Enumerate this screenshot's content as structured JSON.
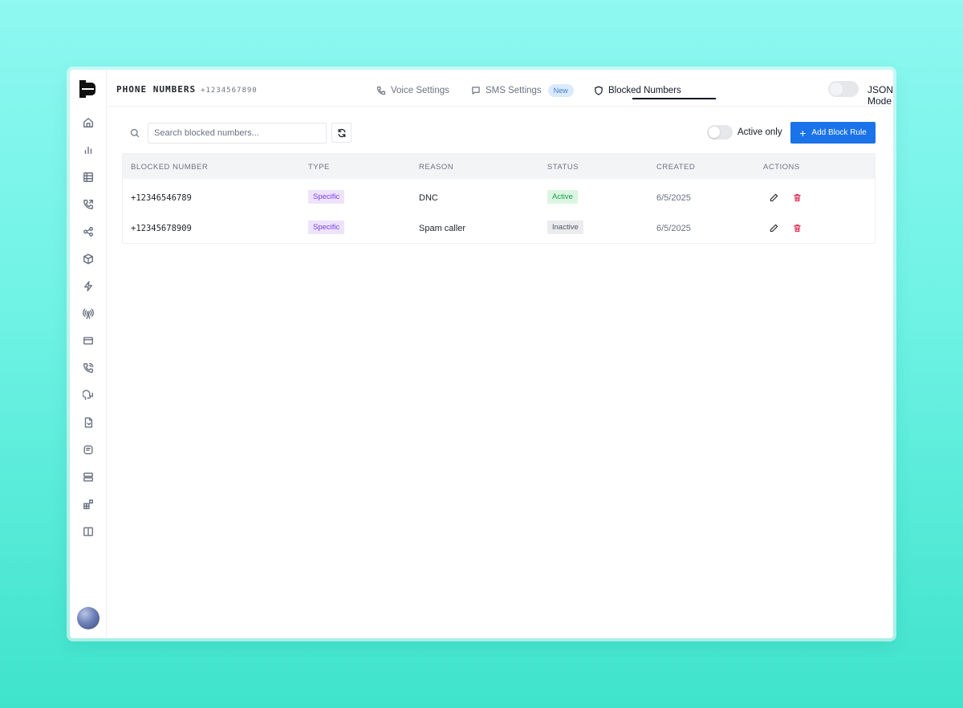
{
  "header": {
    "title": "PHONE NUMBERS",
    "phone": "+1234567890",
    "json_mode_label": "JSON Mode"
  },
  "tabs": [
    {
      "label": "Voice Settings",
      "icon": "phone-icon",
      "active": false
    },
    {
      "label": "SMS Settings",
      "icon": "message-icon",
      "badge": "New",
      "active": false
    },
    {
      "label": "Blocked Numbers",
      "icon": "shield-icon",
      "active": true
    }
  ],
  "sidebar": {
    "items": [
      "home-icon",
      "analytics-icon",
      "table-icon",
      "phone-forward-icon",
      "share-icon",
      "package-icon",
      "bolt-icon",
      "broadcast-icon",
      "credit-card-icon",
      "phone-call-icon",
      "voice-icon",
      "file-icon",
      "message-square-icon",
      "server-icon",
      "widgets-icon",
      "columns-icon"
    ]
  },
  "toolbar": {
    "search_placeholder": "Search blocked numbers...",
    "search_value": "",
    "active_only_label": "Active only",
    "active_only": false,
    "add_button_label": "Add Block Rule"
  },
  "table": {
    "columns": [
      "BLOCKED NUMBER",
      "TYPE",
      "REASON",
      "STATUS",
      "CREATED",
      "ACTIONS"
    ],
    "rows": [
      {
        "number": "+12346546789",
        "type": "Specific",
        "reason": "DNC",
        "status": "Active",
        "created": "6/5/2025"
      },
      {
        "number": "+12345678909",
        "type": "Specific",
        "reason": "Spam caller",
        "status": "Inactive",
        "created": "6/5/2025"
      }
    ]
  },
  "colors": {
    "primary": "#1a73e8",
    "danger": "#e11d48",
    "active_status": "#16a34a",
    "type_badge": "#7c3aed"
  }
}
